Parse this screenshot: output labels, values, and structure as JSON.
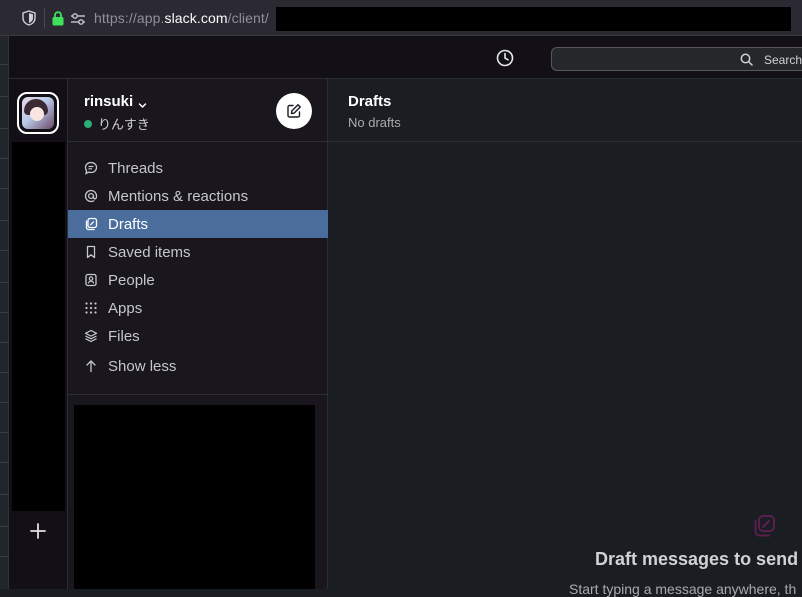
{
  "browser": {
    "url_scheme": "https://app.",
    "url_host": "slack.com",
    "url_path": "/client/"
  },
  "topbar": {
    "history_icon": "clock-icon",
    "search_label": "Search"
  },
  "rail": {
    "add_icon": "plus-icon"
  },
  "workspace": {
    "name": "rinsuki",
    "status": "りんすき",
    "status_color": "#2bac76"
  },
  "sidebar": {
    "items": [
      {
        "label": "Threads",
        "icon": "threads-icon"
      },
      {
        "label": "Mentions & reactions",
        "icon": "at-icon"
      },
      {
        "label": "Drafts",
        "icon": "drafts-icon",
        "active": true
      },
      {
        "label": "Saved items",
        "icon": "bookmark-icon"
      },
      {
        "label": "People",
        "icon": "people-icon"
      },
      {
        "label": "Apps",
        "icon": "apps-grid-icon"
      },
      {
        "label": "Files",
        "icon": "layers-icon"
      },
      {
        "label": "Show less",
        "icon": "arrow-up-icon"
      }
    ],
    "active_color": "#4a6d9c"
  },
  "main": {
    "title": "Drafts",
    "subtitle": "No drafts",
    "empty_title": "Draft messages to send w",
    "empty_body": "Start typing a message anywhere, th"
  }
}
